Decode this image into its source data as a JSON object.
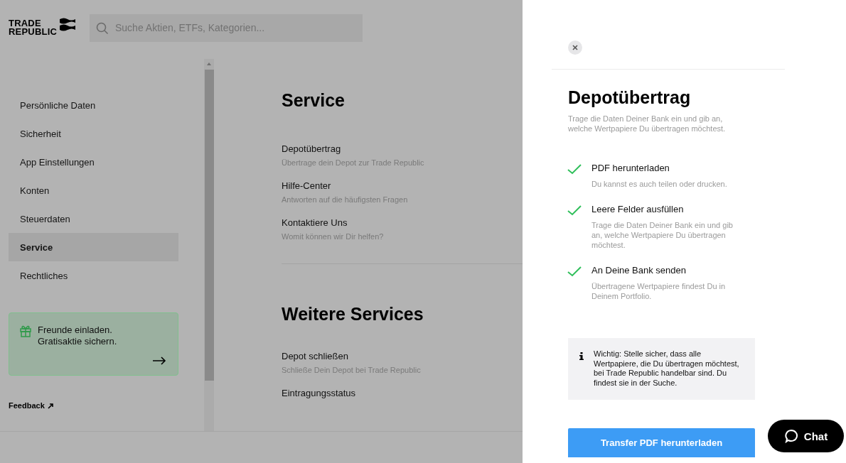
{
  "logo": {
    "lines": [
      "TRADE",
      "REPUBLIC"
    ]
  },
  "search": {
    "placeholder": "Suche Aktien, ETFs, Kategorien..."
  },
  "sidebar": {
    "items": [
      {
        "label": "Persönliche Daten",
        "selected": false
      },
      {
        "label": "Sicherheit",
        "selected": false
      },
      {
        "label": "App Einstellungen",
        "selected": false
      },
      {
        "label": "Konten",
        "selected": false
      },
      {
        "label": "Steuerdaten",
        "selected": false
      },
      {
        "label": "Service",
        "selected": true
      },
      {
        "label": "Rechtliches",
        "selected": false
      }
    ],
    "promo": {
      "text": "Freunde einladen. Gratisaktie sichern."
    },
    "feedback": "Feedback"
  },
  "main": {
    "sections": [
      {
        "title": "Service",
        "items": [
          {
            "title": "Depotübertrag",
            "subtitle": "Übertrage dein Depot zur Trade Republic"
          },
          {
            "title": "Hilfe-Center",
            "subtitle": "Antworten auf die häufigsten Fragen"
          },
          {
            "title": "Kontaktiere Uns",
            "subtitle": "Womit können wir Dir helfen?"
          }
        ]
      },
      {
        "title": "Weitere Services",
        "items": [
          {
            "title": "Depot schließen",
            "subtitle": "Schließe Dein Depot bei Trade Republic"
          },
          {
            "title": "Eintragungsstatus"
          }
        ]
      }
    ]
  },
  "panel": {
    "title": "Depotübertrag",
    "intro": "Trage die Daten Deiner Bank ein und gib an, welche Wertpapiere Du übertragen möchtest.",
    "steps": [
      {
        "title": "PDF herunterladen",
        "text": "Du kannst es auch teilen oder drucken.",
        "checked": true
      },
      {
        "title": "Leere Felder ausfüllen",
        "text": "Trage die Daten Deiner Bank ein und gib an, welche Wertpapiere Du übertragen möchtest.",
        "checked": true
      },
      {
        "title": "An Deine Bank senden",
        "text": "Übertragene Wertpapiere findest Du in Deinem Portfolio.",
        "checked": true
      }
    ],
    "info": "Wichtig: Stelle sicher, dass alle Wertpapiere, die Du übertragen möchtest, bei Trade Republic handelbar sind. Du findest sie in der Suche.",
    "button": "Transfer PDF herunterladen"
  },
  "chat": {
    "label": "Chat"
  }
}
